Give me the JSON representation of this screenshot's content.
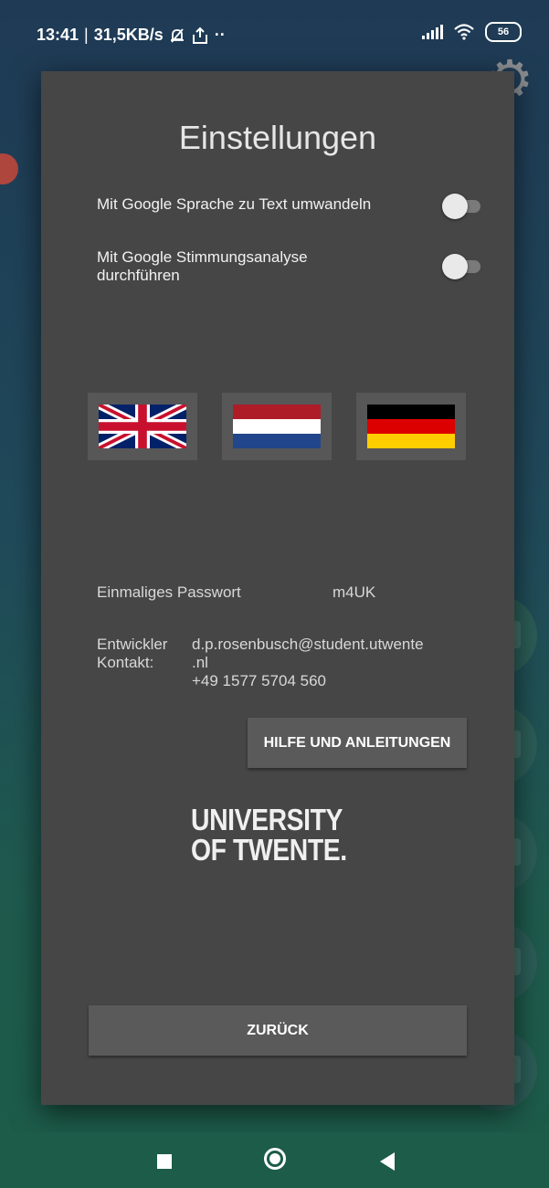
{
  "status_bar": {
    "time": "13:41",
    "separator": "|",
    "network_speed": "31,5KB/s",
    "dots": "··",
    "battery": "56",
    "icons": [
      "bell-off-icon",
      "upload-icon",
      "signal-icon",
      "wifi-icon",
      "battery-icon"
    ]
  },
  "dialog": {
    "title": "Einstellungen",
    "settings": [
      {
        "label": "Mit Google Sprache zu Text umwandeln",
        "enabled": false
      },
      {
        "label": "Mit Google Stimmungsanalyse durchführen",
        "enabled": false
      }
    ],
    "flags": [
      "flag-uk-icon",
      "flag-netherlands-icon",
      "flag-germany-icon"
    ],
    "password": {
      "label": "Einmaliges Passwort",
      "value": "m4UK"
    },
    "developer": {
      "label_line1": "Entwickler",
      "label_line2": "Kontakt:",
      "email_line1": "d.p.rosenbusch@student.utwente",
      "email_line2": ".nl",
      "phone": "+49 1577 5704 560"
    },
    "help_button": "HILFE UND ANLEITUNGEN",
    "logo": {
      "line1": "UNIVERSITY",
      "line2": "OF TWENTE."
    },
    "back_button": "ZURÜCK"
  },
  "colors": {
    "dialog_bg": "#464646",
    "button_bg": "#5a5a5a",
    "background_top": "#1f3a55",
    "background_bottom": "#1c5c48"
  },
  "nav_bar": {
    "icons": [
      "recents-square-icon",
      "home-circle-icon",
      "back-triangle-icon"
    ]
  }
}
